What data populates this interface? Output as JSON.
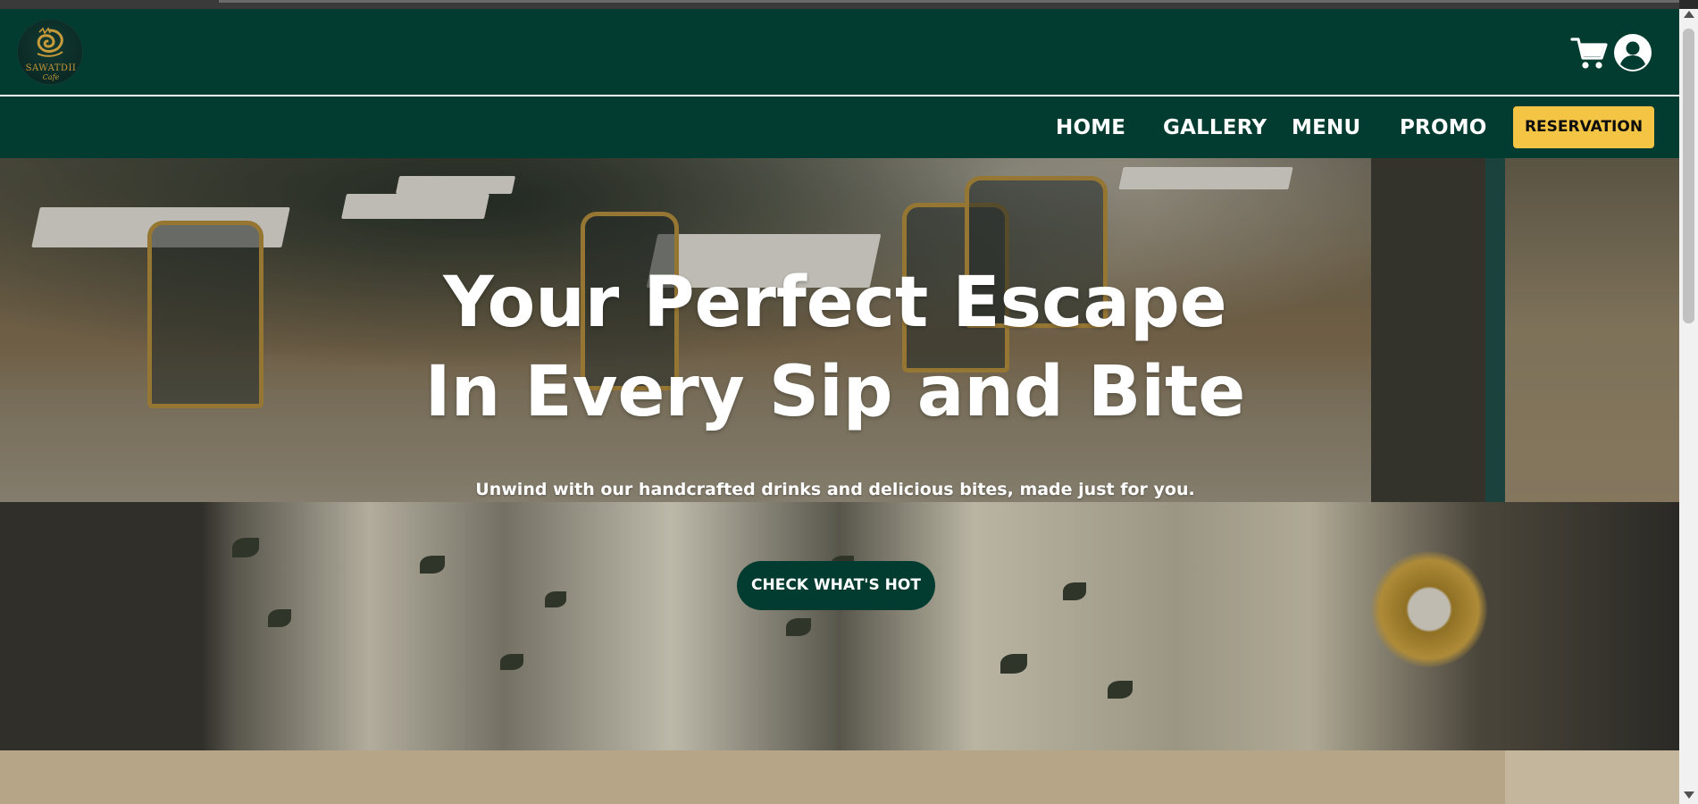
{
  "brand": {
    "logo_text": "SAWATDII",
    "logo_subtext": "Cafe"
  },
  "header": {
    "icons": [
      "cart-icon",
      "user-icon"
    ]
  },
  "nav": {
    "items": [
      {
        "label": "HOME"
      },
      {
        "label": "GALLERY"
      },
      {
        "label": "MENU"
      },
      {
        "label": "PROMO"
      }
    ],
    "reservation_label": "RESERVATION"
  },
  "hero": {
    "title_line1": "Your Perfect Escape",
    "title_line2": "In Every Sip and Bite",
    "subtitle": "Unwind with our handcrafted drinks and delicious bites, made just for you.",
    "cta_label": "CHECK WHAT'S HOT"
  },
  "colors": {
    "brand_green": "#023c30",
    "accent_yellow": "#f4c544",
    "logo_gold": "#c79a3a"
  }
}
